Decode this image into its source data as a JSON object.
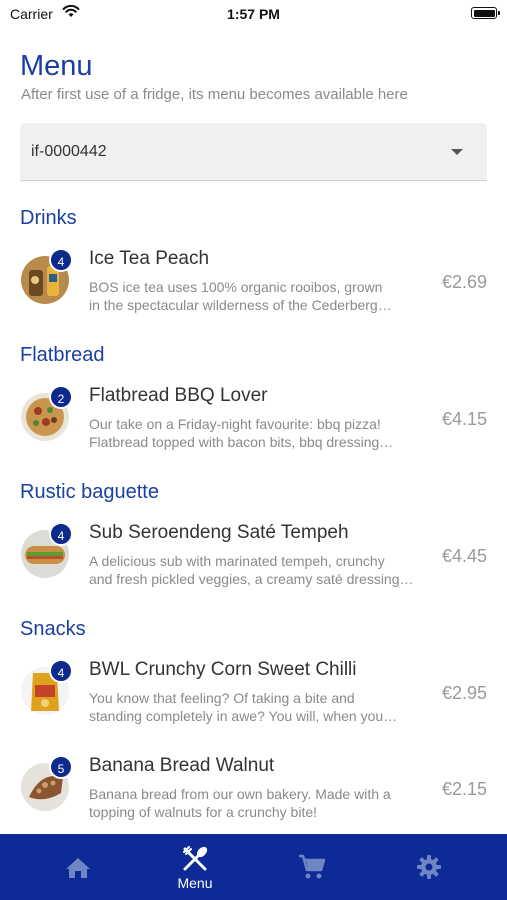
{
  "status_bar": {
    "carrier": "Carrier",
    "time": "1:57 PM"
  },
  "header": {
    "title": "Menu",
    "subtitle": "After first use of a fridge, its menu becomes available here"
  },
  "fridge_select": {
    "value": "if-0000442"
  },
  "sections": [
    {
      "title": "Drinks",
      "items": [
        {
          "name": "Ice Tea Peach",
          "desc1": "BOS ice tea uses 100% organic rooibos, grown",
          "desc2": "in the spectacular wilderness of the Cederberg…",
          "price": "€2.69",
          "qty": "4"
        }
      ]
    },
    {
      "title": "Flatbread",
      "items": [
        {
          "name": "Flatbread BBQ Lover",
          "desc1": "Our take on a Friday-night favourite: bbq pizza!",
          "desc2": "Flatbread topped with bacon bits, bbq dressing…",
          "price": "€4.15",
          "qty": "2"
        }
      ]
    },
    {
      "title": "Rustic baguette",
      "items": [
        {
          "name": "Sub Seroendeng Saté Tempeh",
          "desc1": "A delicious sub with marinated tempeh, crunchy",
          "desc2": "and fresh pickled veggies, a creamy saté dressing…",
          "price": "€4.45",
          "qty": "4"
        }
      ]
    },
    {
      "title": "Snacks",
      "items": [
        {
          "name": "BWL Crunchy Corn Sweet Chilli",
          "desc1": "You know that feeling? Of taking a bite and",
          "desc2": "standing completely in awe? You will, when you…",
          "price": "€2.95",
          "qty": "4"
        },
        {
          "name": "Banana Bread Walnut",
          "desc1": "Banana bread from our own bakery. Made with a",
          "desc2": "topping of walnuts for a crunchy bite!",
          "price": "€2.15",
          "qty": "5"
        }
      ]
    }
  ],
  "tabbar": {
    "home_icon": "home-icon",
    "menu_icon": "cutlery-icon",
    "menu_label": "Menu",
    "cart_icon": "cart-icon",
    "settings_icon": "gear-icon"
  },
  "colors": {
    "brand": "#1a3fa0",
    "tabbar": "#0d2a96",
    "badge": "#0c2a8c"
  }
}
